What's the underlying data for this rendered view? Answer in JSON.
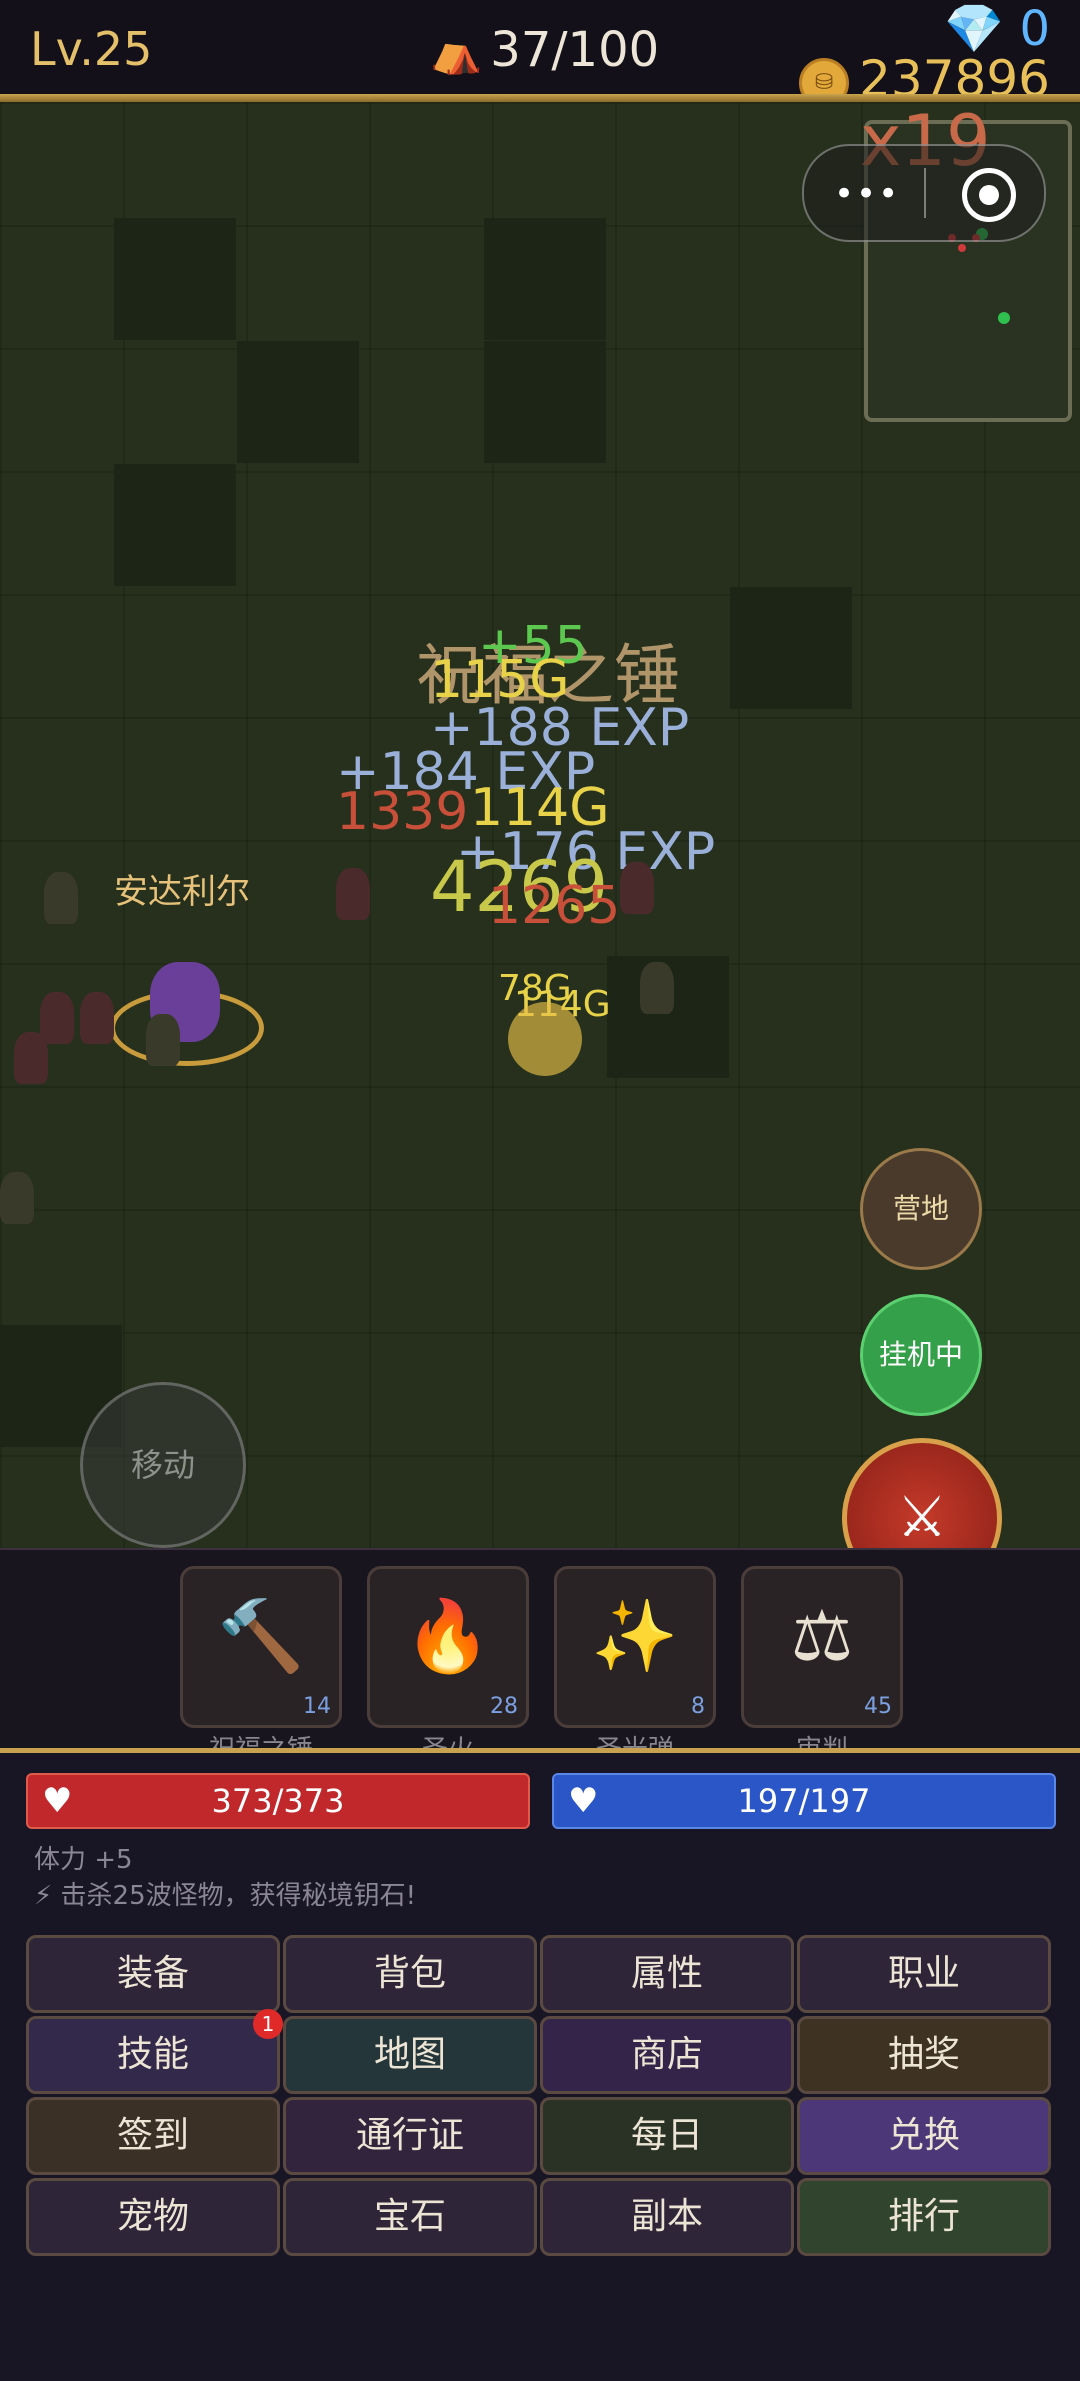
{
  "hud": {
    "level": "Lv.25",
    "stage_icon": "tent-tree-icon",
    "stage": "37/100",
    "gems": "0",
    "gold": "237896"
  },
  "combo": "x19",
  "floating_texts": [
    {
      "text": "祝福之锤",
      "color": "#b0946a"
    },
    {
      "text": "+55",
      "color": "#5cc850"
    },
    {
      "text": "115G",
      "color": "#e8d24a"
    },
    {
      "text": "+188 EXP",
      "color": "#9ab0d8"
    },
    {
      "text": "+184 EXP",
      "color": "#9ab0d8"
    },
    {
      "text": "1339",
      "color": "#c8503a"
    },
    {
      "text": "114G",
      "color": "#e8d24a"
    },
    {
      "text": "+176 EXP",
      "color": "#9ab0d8"
    },
    {
      "text": "4269",
      "color": "#c8c84a"
    },
    {
      "text": "1265",
      "color": "#c8503a"
    },
    {
      "text": "78G",
      "color": "#e8d24a"
    },
    {
      "text": "114G",
      "color": "#e8d24a"
    }
  ],
  "npc": {
    "name": "安达利尔"
  },
  "controls": {
    "move": "移动",
    "camp": "营地",
    "auto": "挂机中",
    "attack_icon": "crossed-swords-icon"
  },
  "skills": [
    {
      "name": "祝福之锤",
      "level": "14",
      "icon": "hammer-icon",
      "glyph": "🔨"
    },
    {
      "name": "圣火",
      "level": "28",
      "icon": "flame-icon",
      "glyph": "🔥"
    },
    {
      "name": "圣光弹",
      "level": "8",
      "icon": "sparkle-icon",
      "glyph": "✨"
    },
    {
      "name": "审判",
      "level": "45",
      "icon": "scales-icon",
      "glyph": "⚖"
    }
  ],
  "status": {
    "hp": "373/373",
    "mp": "197/197",
    "tip_stamina": "体力 +5",
    "tip_quest": "⚡ 击杀25波怪物，获得秘境钥石!"
  },
  "menu": [
    {
      "label": "装备",
      "bg": "#2e2638"
    },
    {
      "label": "背包",
      "bg": "#2e2638"
    },
    {
      "label": "属性",
      "bg": "#2e2638"
    },
    {
      "label": "职业",
      "bg": "#2e2638"
    },
    {
      "label": "技能",
      "bg": "#33294a",
      "badge": "1"
    },
    {
      "label": "地图",
      "bg": "#24363a"
    },
    {
      "label": "商店",
      "bg": "#34244a"
    },
    {
      "label": "抽奖",
      "bg": "#3e3222"
    },
    {
      "label": "签到",
      "bg": "#3a3026"
    },
    {
      "label": "通行证",
      "bg": "#33243e"
    },
    {
      "label": "每日",
      "bg": "#2a3226"
    },
    {
      "label": "兑换",
      "bg": "#4c3878"
    },
    {
      "label": "宠物",
      "bg": "#2e2638"
    },
    {
      "label": "宝石",
      "bg": "#2e2638"
    },
    {
      "label": "副本",
      "bg": "#2e2638"
    },
    {
      "label": "排行",
      "bg": "#30442e"
    }
  ]
}
